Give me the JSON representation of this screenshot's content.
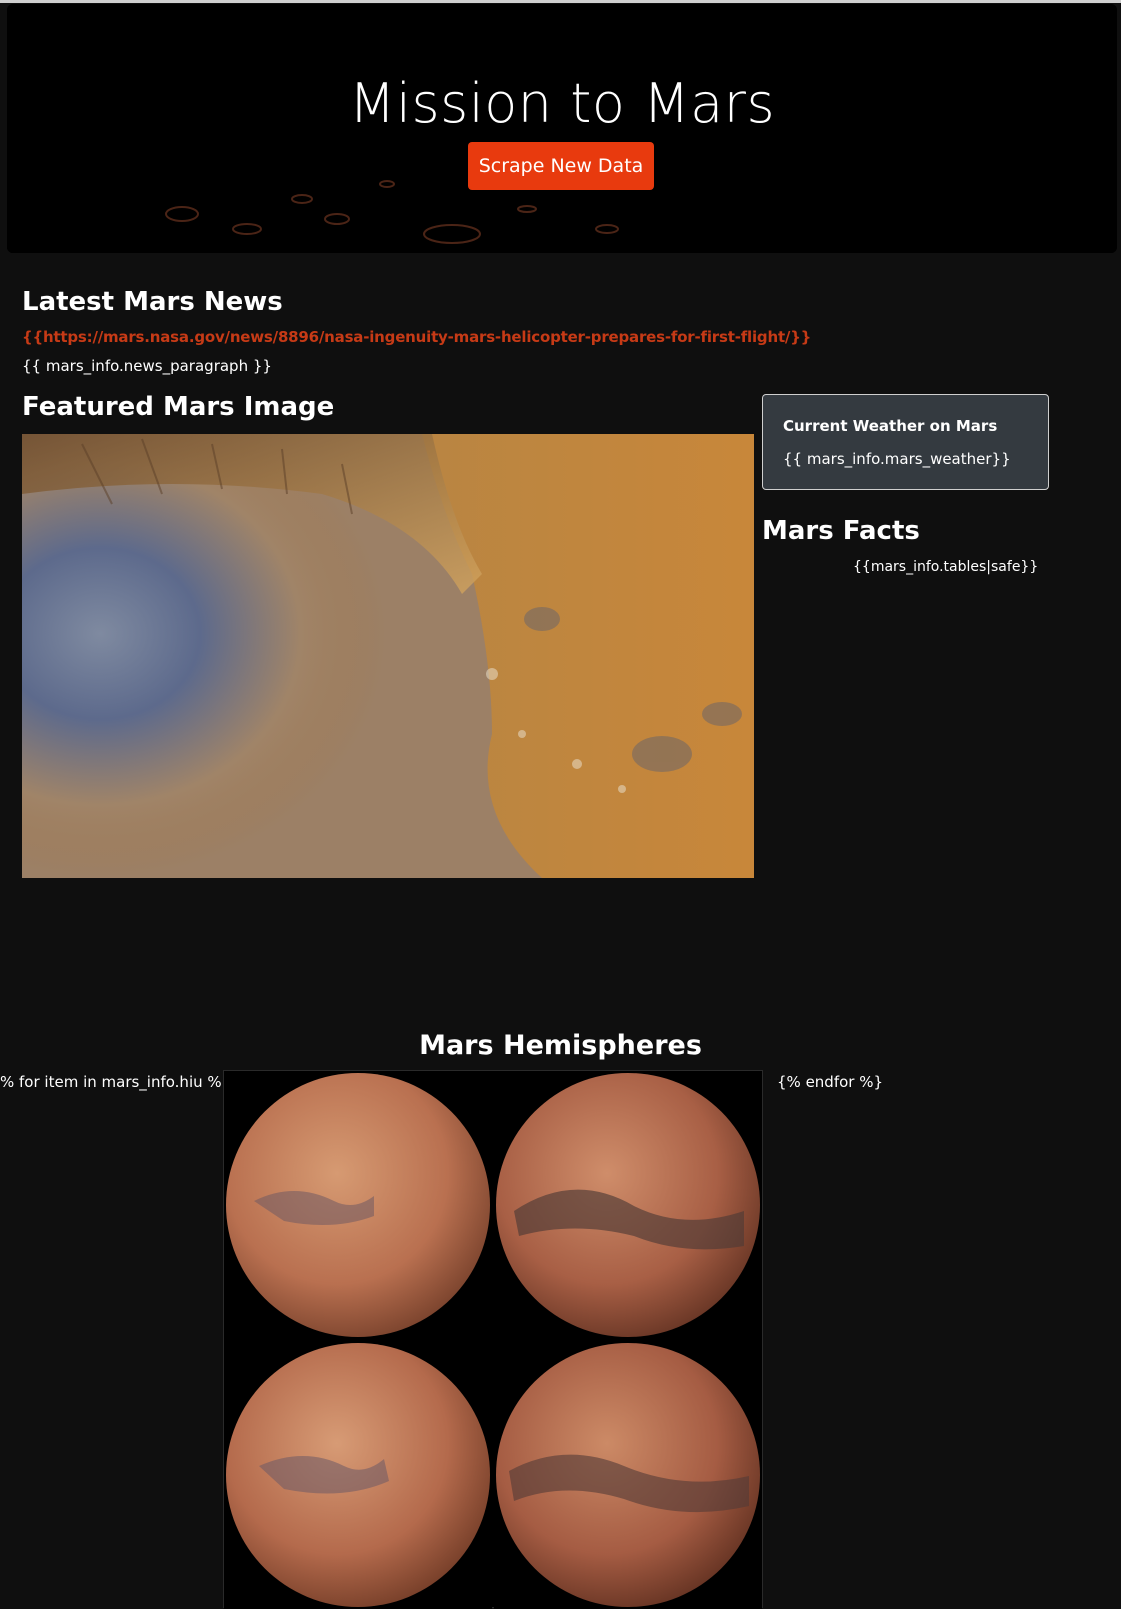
{
  "hero": {
    "title": "Mission to Mars",
    "button_label": "Scrape New Data"
  },
  "news": {
    "heading": "Latest Mars News",
    "link_text": "{{https://mars.nasa.gov/news/8896/nasa-ingenuity-mars-helicopter-prepares-for-first-flight/}}",
    "paragraph": "{{ mars_info.news_paragraph }}"
  },
  "featured": {
    "heading": "Featured Mars Image"
  },
  "weather": {
    "title": "Current Weather on Mars",
    "value": "{{ mars_info.mars_weather}}"
  },
  "facts": {
    "heading": "Mars Facts",
    "table_placeholder": "{{mars_info.tables|safe}}"
  },
  "hemispheres": {
    "heading": "Mars Hemispheres",
    "loop_start": "% for item in mars_info.hiu %}",
    "loop_end": "{% endfor %}",
    "images": [
      "hemisphere-1",
      "hemisphere-2",
      "hemisphere-3",
      "hemisphere-4"
    ]
  },
  "colors": {
    "background": "#0f0f0f",
    "accent_button": "#e83a0e",
    "link": "#c63a16",
    "card": "#343a40"
  }
}
